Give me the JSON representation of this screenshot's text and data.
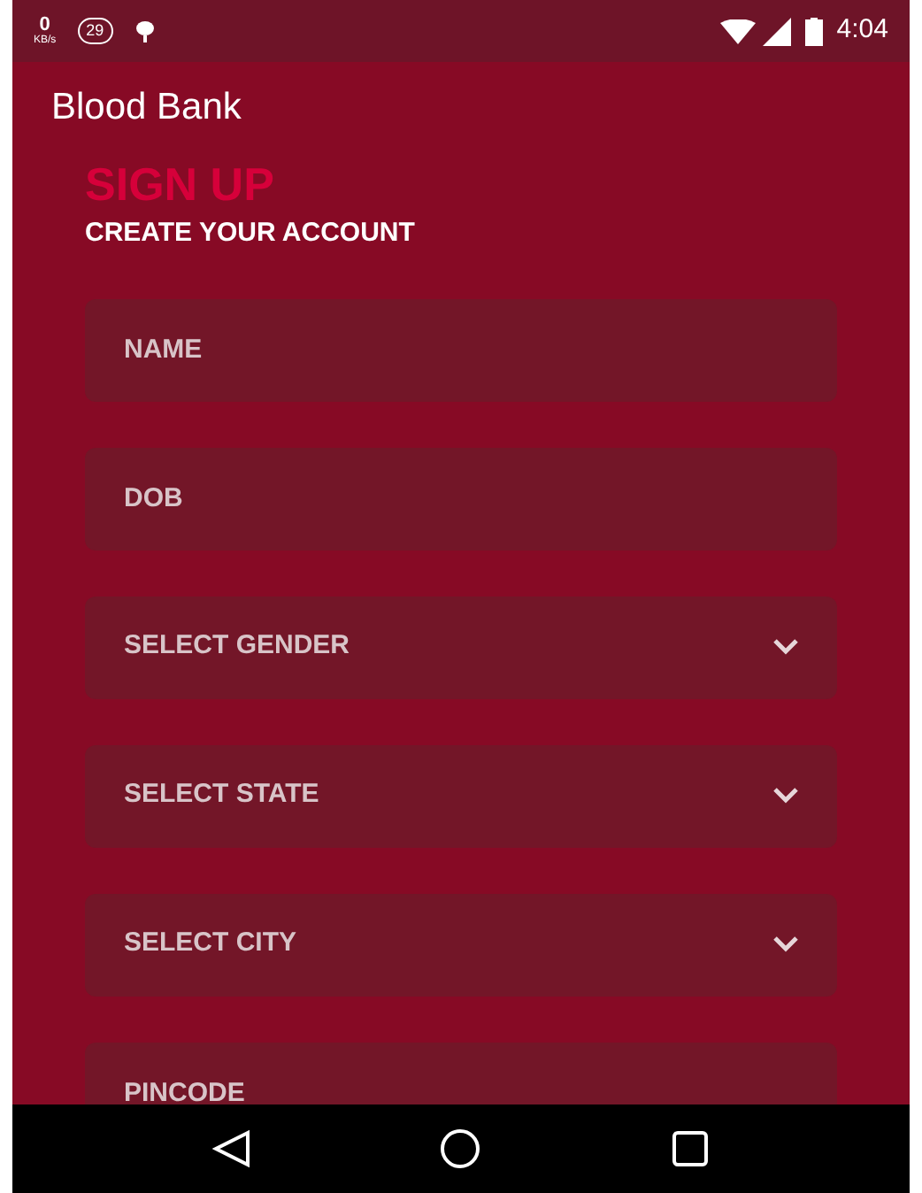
{
  "status_bar": {
    "net_speed": "0",
    "net_unit": "KB/s",
    "badge": "29",
    "time": "4:04"
  },
  "app_bar": {
    "title": "Blood Bank"
  },
  "heading": {
    "title": "SIGN UP",
    "subtitle": "CREATE YOUR ACCOUNT"
  },
  "fields": [
    {
      "kind": "text",
      "placeholder": "NAME"
    },
    {
      "kind": "text",
      "placeholder": "DOB"
    },
    {
      "kind": "select",
      "placeholder": "SELECT GENDER"
    },
    {
      "kind": "select",
      "placeholder": "SELECT STATE"
    },
    {
      "kind": "select",
      "placeholder": "SELECT CITY"
    },
    {
      "kind": "text",
      "placeholder": "PINCODE"
    }
  ]
}
